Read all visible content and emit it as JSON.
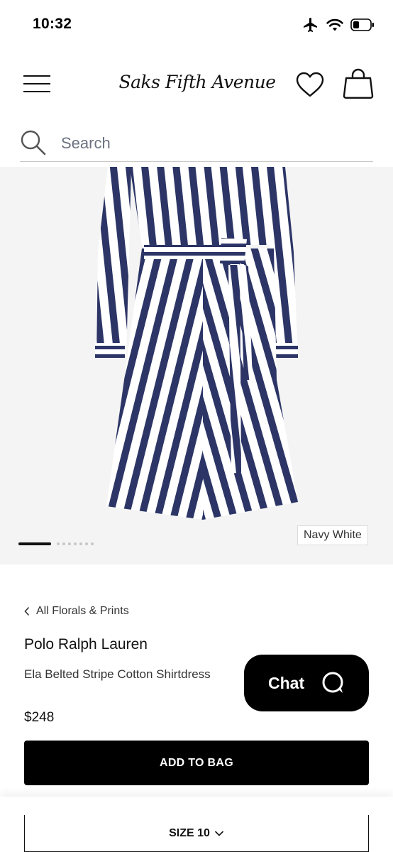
{
  "status_bar": {
    "time": "10:32",
    "icons": [
      "airplane-icon",
      "wifi-icon",
      "battery-icon"
    ]
  },
  "header": {
    "logo_text": "Saks Fifth Avenue",
    "icons": [
      "menu-icon",
      "heart-icon",
      "shopping-bag-icon"
    ]
  },
  "search": {
    "placeholder": "Search",
    "value": ""
  },
  "gallery": {
    "color_label": "Navy White",
    "image_count": 8,
    "active_index": 0
  },
  "product": {
    "breadcrumb": "All Florals & Prints",
    "brand": "Polo Ralph Lauren",
    "name": "Ela Belted Stripe Cotton Shirtdress",
    "price": "$248"
  },
  "chat": {
    "label": "Chat"
  },
  "actions": {
    "add_to_bag": "ADD TO BAG",
    "size_label": "SIZE 10"
  },
  "colors": {
    "navy": "#2c3566",
    "black": "#000000",
    "gallery_bg": "#f4f4f4"
  }
}
